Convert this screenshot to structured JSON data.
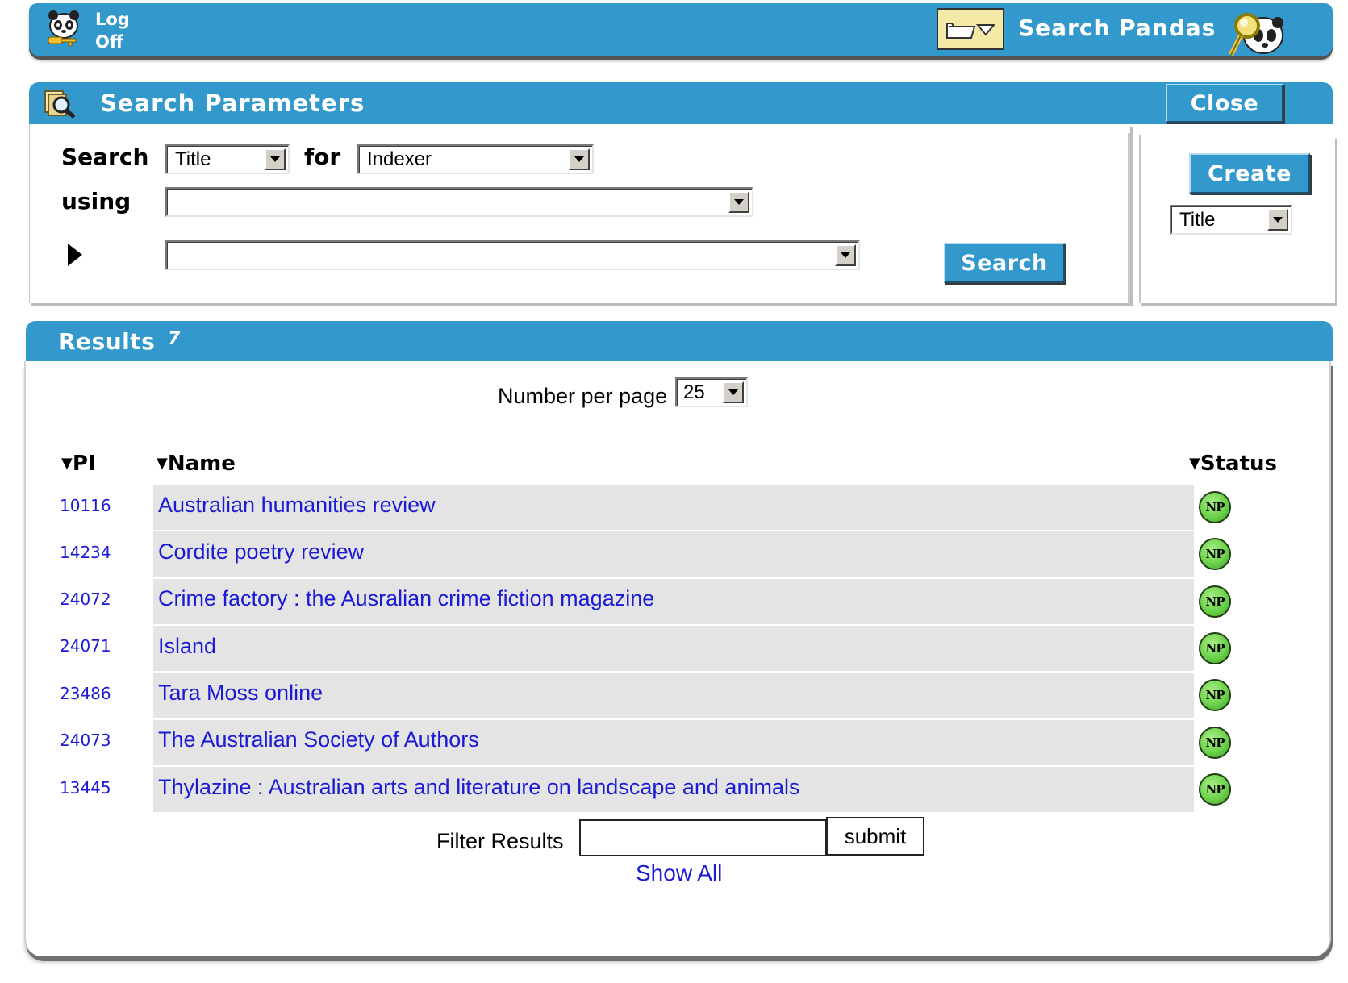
{
  "topbar": {
    "logoff_label": "Log\nOff",
    "search_pandas_label": "Search Pandas"
  },
  "search_params": {
    "title": "Search Parameters",
    "close_label": "Close",
    "search_label": "Search",
    "for_label": "for",
    "using_label": "using",
    "search_field_value": "Title",
    "for_value": "Indexer",
    "using_value": "",
    "criteria_value": "",
    "search_button_label": "Search",
    "create_button_label": "Create",
    "create_type_value": "Title"
  },
  "results": {
    "title": "Results",
    "count": "7",
    "number_per_page_label": "Number per page",
    "number_per_page_value": "25",
    "columns": {
      "pi": "PI",
      "name": "Name",
      "status": "Status"
    },
    "sort_glyph": "▼",
    "rows": [
      {
        "pi": "10116",
        "name": "Australian humanities review",
        "status": "NP"
      },
      {
        "pi": "14234",
        "name": "Cordite poetry review",
        "status": "NP"
      },
      {
        "pi": "24072",
        "name": "Crime factory : the Ausralian crime fiction magazine",
        "status": "NP"
      },
      {
        "pi": "24071",
        "name": "Island",
        "status": "NP"
      },
      {
        "pi": "23486",
        "name": "Tara Moss online",
        "status": "NP"
      },
      {
        "pi": "24073",
        "name": "The Australian Society of Authors",
        "status": "NP"
      },
      {
        "pi": "13445",
        "name": "Thylazine : Australian arts and literature on landscape and animals",
        "status": "NP"
      }
    ],
    "filter_label": "Filter Results",
    "filter_value": "",
    "submit_label": "submit",
    "show_all_label": "Show All"
  },
  "colors": {
    "header_blue": "#3399cc",
    "link_blue": "#1b1bd6",
    "row_grey": "#e4e4e4",
    "status_green": "#6cd24a"
  },
  "icons": [
    "panda-logoff-icon",
    "folder-dropdown-icon",
    "panda-magnifier-icon",
    "search-parameters-icon",
    "play-triangle-icon",
    "np-status-icon"
  ]
}
